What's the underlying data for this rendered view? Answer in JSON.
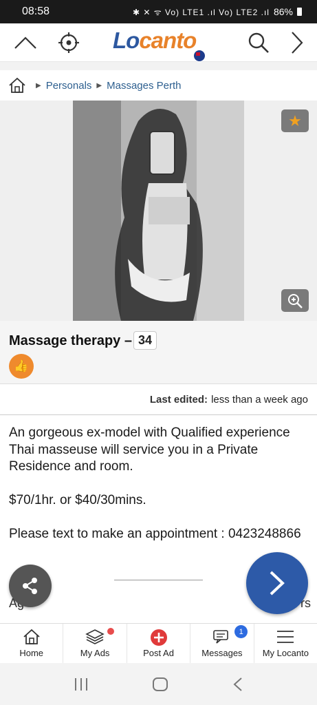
{
  "status_bar": {
    "time": "08:58",
    "icons": "✱ ✕ ᯤ Vo) LTE1 .ıl Vo) LTE2 .ıl",
    "battery": "86%"
  },
  "header": {
    "logo_lo": "Lo",
    "logo_canto": "canto"
  },
  "breadcrumb": {
    "item1": "Personals",
    "item2": "Massages Perth"
  },
  "listing": {
    "title": "Massage therapy –",
    "age": "34",
    "last_edited_label": "Last edited:",
    "last_edited_value": "less than a week ago",
    "description": [
      "An gorgeous ex-model with Qualified experience Thai masseuse will service you in a Private Residence and room.",
      "$70/1hr. or $40/30mins.",
      "Please text to make an appointment : 0423248866"
    ],
    "peek_left": "Ag",
    "peek_right": "rs"
  },
  "bottom_nav": {
    "home": "Home",
    "my_ads": "My Ads",
    "post_ad": "Post Ad",
    "messages": "Messages",
    "messages_badge": "1",
    "my_locanto": "My Locanto"
  },
  "colors": {
    "brand_blue": "#2d58a0",
    "brand_orange": "#e8822a",
    "fab_blue": "#2d5aa8",
    "post_red": "#e03a3a"
  }
}
